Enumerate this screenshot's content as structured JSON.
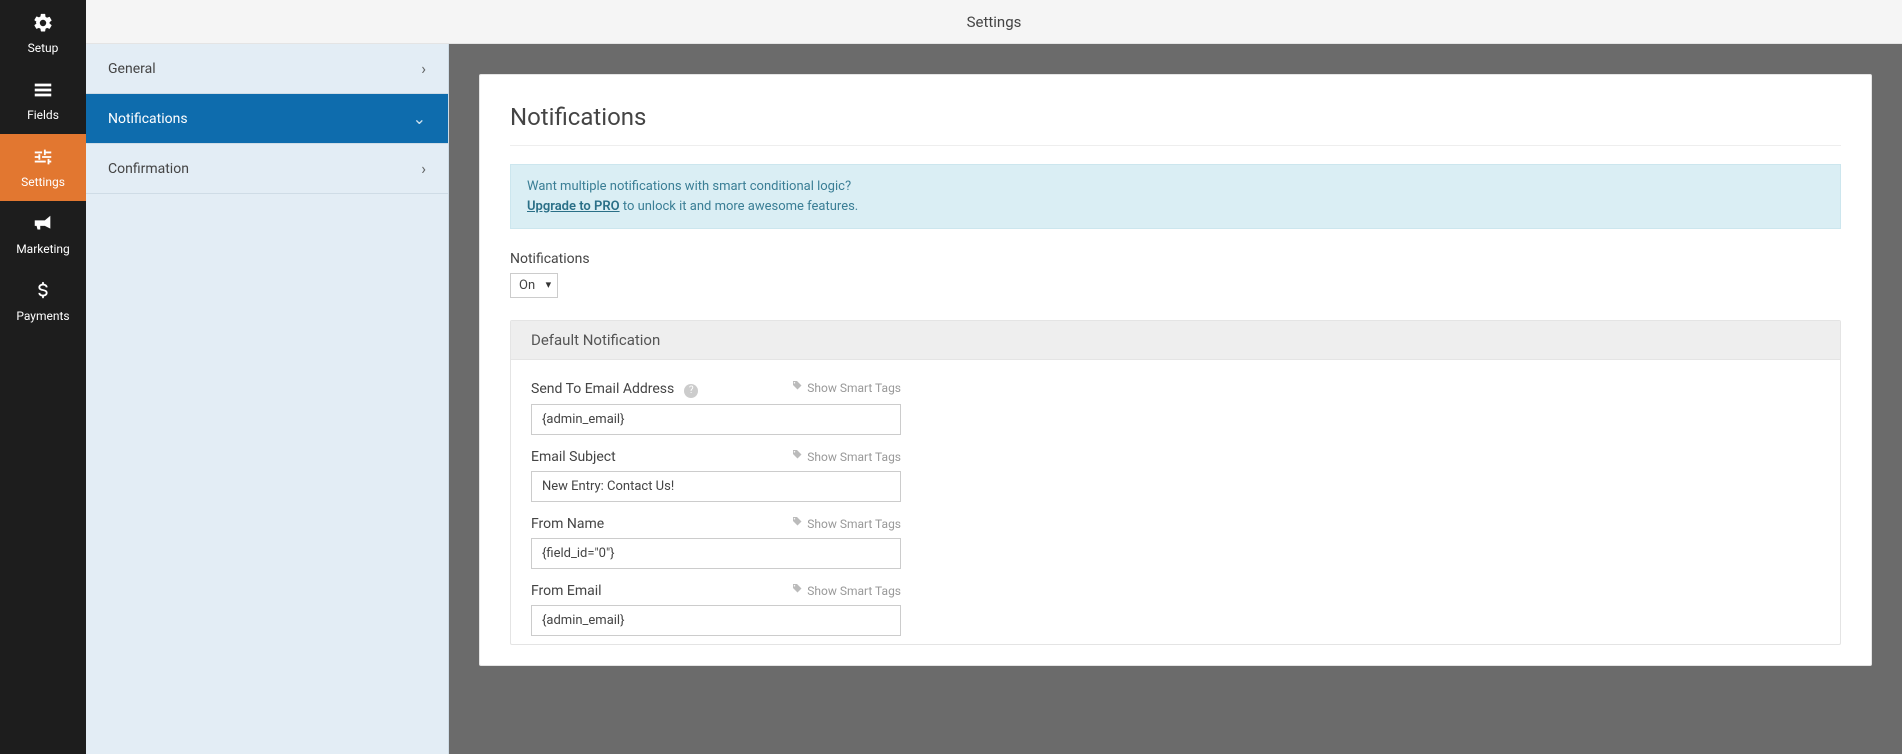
{
  "topbar": {
    "title": "Settings"
  },
  "rail": {
    "items": [
      {
        "label": "Setup"
      },
      {
        "label": "Fields"
      },
      {
        "label": "Settings"
      },
      {
        "label": "Marketing"
      },
      {
        "label": "Payments"
      }
    ]
  },
  "side": {
    "items": [
      {
        "label": "General",
        "chevron": "›"
      },
      {
        "label": "Notifications",
        "chevron": "⌄"
      },
      {
        "label": "Confirmation",
        "chevron": "›"
      }
    ]
  },
  "content": {
    "heading": "Notifications",
    "promo_line1": "Want multiple notifications with smart conditional logic?",
    "promo_link": "Upgrade to PRO",
    "promo_line2_rest": " to unlock it and more awesome features.",
    "notifications_label": "Notifications",
    "notifications_value": "On",
    "card_title": "Default Notification",
    "smart_tags_label": "Show Smart Tags",
    "fields": [
      {
        "label": "Send To Email Address",
        "value": "{admin_email}",
        "help": true
      },
      {
        "label": "Email Subject",
        "value": "New Entry: Contact Us!",
        "help": false
      },
      {
        "label": "From Name",
        "value": "{field_id=\"0\"}",
        "help": false
      },
      {
        "label": "From Email",
        "value": "{admin_email}",
        "help": false
      }
    ]
  }
}
